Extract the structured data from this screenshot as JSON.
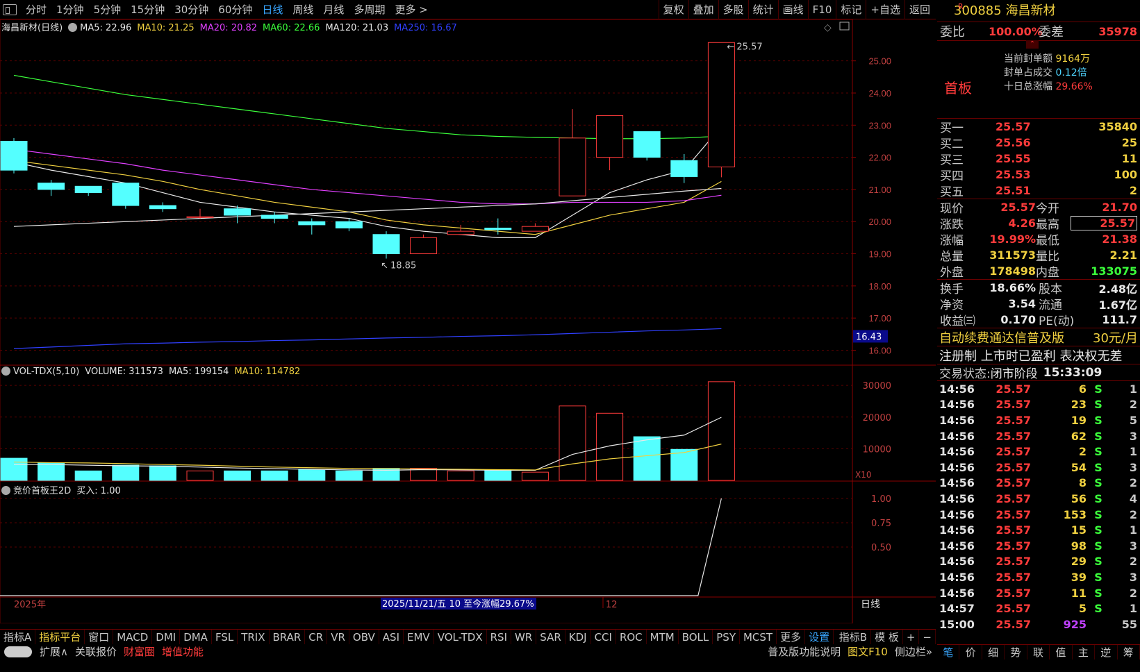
{
  "toolbar": {
    "periods": [
      "分时",
      "1分钟",
      "5分钟",
      "15分钟",
      "30分钟",
      "60分钟",
      "日线",
      "周线",
      "月线",
      "多周期",
      "更多 >"
    ],
    "active": "日线",
    "buttons": [
      "复权",
      "叠加",
      "多股",
      "统计",
      "画线",
      "F10",
      "标记",
      "+自选",
      "返回"
    ]
  },
  "main_legend": {
    "name": "海昌新材(日线)",
    "items": [
      {
        "label": "MA5: 22.96",
        "color": "#e8e8e8"
      },
      {
        "label": "MA10: 21.25",
        "color": "#f0d040"
      },
      {
        "label": "MA20: 20.82",
        "color": "#e040ff"
      },
      {
        "label": "MA60: 22.66",
        "color": "#3bff3b"
      },
      {
        "label": "MA120: 21.03",
        "color": "#e8e8e8"
      },
      {
        "label": "MA250: 16.67",
        "color": "#3040ff"
      }
    ]
  },
  "vol_legend": {
    "name": "VOL-TDX(5,10)",
    "items": [
      {
        "label": "VOLUME: 311573",
        "color": "#e8e8e8"
      },
      {
        "label": "MA5: 199154",
        "color": "#e8e8e8"
      },
      {
        "label": "MA10: 114782",
        "color": "#f0d040"
      }
    ]
  },
  "ind_legend": {
    "name": "竞价首板王2D",
    "items": [
      {
        "label": "买入: 1.00",
        "color": "#e8e8e8"
      }
    ]
  },
  "price_axis": {
    "labels": [
      "25.00",
      "24.00",
      "23.00",
      "22.00",
      "21.00",
      "20.00",
      "19.00",
      "18.00",
      "17.00",
      "16.00"
    ],
    "ma250_label": "16.43"
  },
  "vol_axis": {
    "labels": [
      "30000",
      "20000",
      "10000"
    ],
    "unit": "X10"
  },
  "ind_axis": {
    "labels": [
      "1.00",
      "0.75",
      "0.50"
    ]
  },
  "annotations": {
    "high": "25.57",
    "low": "18.85"
  },
  "time_axis": {
    "year": "2025年",
    "month": "12",
    "cursor": "2025/11/21/五 10 至今涨幅29.67%",
    "period": "日线"
  },
  "chart_data": {
    "type": "candlestick",
    "candles": [
      {
        "o": 21.6,
        "c": 22.5,
        "h": 22.6,
        "l": 21.5,
        "up": false
      },
      {
        "o": 21.2,
        "c": 21.0,
        "h": 21.3,
        "l": 20.8,
        "up": false
      },
      {
        "o": 21.1,
        "c": 20.9,
        "h": 21.1,
        "l": 20.8,
        "up": false
      },
      {
        "o": 21.2,
        "c": 20.5,
        "h": 21.2,
        "l": 20.4,
        "up": false
      },
      {
        "o": 20.5,
        "c": 20.4,
        "h": 20.6,
        "l": 20.3,
        "up": false
      },
      {
        "o": 20.15,
        "c": 20.15,
        "h": 20.4,
        "l": 20.1,
        "up": true
      },
      {
        "o": 20.4,
        "c": 20.2,
        "h": 20.5,
        "l": 19.95,
        "up": false
      },
      {
        "o": 20.2,
        "c": 20.1,
        "h": 20.3,
        "l": 19.95,
        "up": false
      },
      {
        "o": 20.0,
        "c": 19.9,
        "h": 20.1,
        "l": 19.6,
        "up": false
      },
      {
        "o": 20.0,
        "c": 19.8,
        "h": 20.1,
        "l": 19.7,
        "up": false
      },
      {
        "o": 19.6,
        "c": 19.0,
        "h": 19.7,
        "l": 18.85,
        "up": false
      },
      {
        "o": 19.0,
        "c": 19.5,
        "h": 19.6,
        "l": 19.0,
        "up": true
      },
      {
        "o": 19.6,
        "c": 19.7,
        "h": 19.9,
        "l": 19.6,
        "up": true
      },
      {
        "o": 19.8,
        "c": 19.75,
        "h": 20.1,
        "l": 19.6,
        "up": false
      },
      {
        "o": 19.7,
        "c": 19.85,
        "h": 19.95,
        "l": 19.7,
        "up": true
      },
      {
        "o": 20.8,
        "c": 22.6,
        "h": 23.5,
        "l": 20.8,
        "up": true
      },
      {
        "o": 22.0,
        "c": 23.3,
        "h": 23.3,
        "l": 21.6,
        "up": true
      },
      {
        "o": 22.8,
        "c": 22.0,
        "h": 22.8,
        "l": 21.9,
        "up": false
      },
      {
        "o": 21.9,
        "c": 21.4,
        "h": 22.1,
        "l": 21.2,
        "up": false
      },
      {
        "o": 21.7,
        "c": 25.57,
        "h": 25.57,
        "l": 21.38,
        "up": true
      }
    ],
    "volume": [
      {
        "v": 7000,
        "up": false
      },
      {
        "v": 5500,
        "up": false
      },
      {
        "v": 3000,
        "up": false
      },
      {
        "v": 4800,
        "up": false
      },
      {
        "v": 4600,
        "up": false
      },
      {
        "v": 3000,
        "up": true
      },
      {
        "v": 3000,
        "up": false
      },
      {
        "v": 3000,
        "up": false
      },
      {
        "v": 3400,
        "up": false
      },
      {
        "v": 3000,
        "up": false
      },
      {
        "v": 3800,
        "up": false
      },
      {
        "v": 3800,
        "up": true
      },
      {
        "v": 3000,
        "up": true
      },
      {
        "v": 3200,
        "up": false
      },
      {
        "v": 2600,
        "up": true
      },
      {
        "v": 23500,
        "up": true
      },
      {
        "v": 21200,
        "up": true
      },
      {
        "v": 13800,
        "up": false
      },
      {
        "v": 9800,
        "up": false
      },
      {
        "v": 31157,
        "up": true
      }
    ],
    "ma_series": [
      {
        "name": "MA5",
        "color": "#e8e8e8",
        "values": [
          21.85,
          21.6,
          21.4,
          21.2,
          20.9,
          20.6,
          20.45,
          20.3,
          20.2,
          20.1,
          19.85,
          19.7,
          19.6,
          19.5,
          19.5,
          20.2,
          20.9,
          21.3,
          21.6,
          22.96
        ]
      },
      {
        "name": "MA10",
        "color": "#f0d040",
        "values": [
          21.9,
          21.75,
          21.6,
          21.45,
          21.25,
          21.0,
          20.8,
          20.6,
          20.45,
          20.3,
          20.05,
          19.9,
          19.8,
          19.7,
          19.6,
          19.9,
          20.2,
          20.4,
          20.6,
          21.25
        ]
      },
      {
        "name": "MA20",
        "color": "#e040ff",
        "values": [
          22.25,
          22.1,
          21.95,
          21.8,
          21.6,
          21.45,
          21.3,
          21.15,
          21.0,
          20.9,
          20.8,
          20.7,
          20.6,
          20.55,
          20.55,
          20.6,
          20.6,
          20.6,
          20.65,
          20.82
        ]
      },
      {
        "name": "MA60",
        "color": "#3bff3b",
        "values": [
          24.55,
          24.35,
          24.15,
          23.95,
          23.8,
          23.65,
          23.5,
          23.35,
          23.2,
          23.05,
          22.9,
          22.8,
          22.7,
          22.65,
          22.62,
          22.6,
          22.58,
          22.58,
          22.6,
          22.66
        ]
      },
      {
        "name": "MA120",
        "color": "#e8e8e8",
        "values": [
          19.85,
          19.9,
          19.95,
          20.0,
          20.05,
          20.1,
          20.15,
          20.2,
          20.25,
          20.3,
          20.35,
          20.4,
          20.45,
          20.5,
          20.55,
          20.65,
          20.75,
          20.85,
          20.95,
          21.03
        ]
      },
      {
        "name": "MA250",
        "color": "#3040ff",
        "values": [
          16.05,
          16.1,
          16.15,
          16.2,
          16.22,
          16.25,
          16.27,
          16.3,
          16.32,
          16.35,
          16.38,
          16.4,
          16.43,
          16.45,
          16.48,
          16.52,
          16.56,
          16.6,
          16.63,
          16.67
        ]
      }
    ],
    "vol_ma5": [
      5000,
      5000,
      4800,
      4600,
      4500,
      4200,
      3900,
      3700,
      3500,
      3300,
      3200,
      3400,
      3300,
      3200,
      3200,
      8200,
      10900,
      12800,
      14300,
      19915
    ],
    "vol_ma10": [
      5800,
      5600,
      5500,
      5300,
      5000,
      4800,
      4500,
      4200,
      4000,
      3800,
      3700,
      3600,
      3500,
      3400,
      3300,
      5200,
      6800,
      7800,
      8800,
      11478
    ],
    "ind_values": [
      0,
      0,
      0,
      0,
      0,
      0,
      0,
      0,
      0,
      0,
      0,
      0,
      0,
      0,
      0,
      0,
      0,
      0,
      0,
      1.0
    ],
    "ylim": [
      15.6,
      25.9
    ]
  },
  "rp": {
    "code": "300885",
    "name": "海昌新材",
    "r_badge": "R",
    "weibi_l": "委比",
    "weibi_v": "100.00%",
    "weicha_l": "委差",
    "weicha_v": "35978",
    "board": "首板",
    "seal_l": "当前封单额",
    "seal_v": "9164万",
    "ratio_l": "封单占成交",
    "ratio_v": "0.12倍",
    "ten_l": "十日总涨幅",
    "ten_v": "29.66%",
    "bids": [
      [
        "买一",
        "25.57",
        "35840"
      ],
      [
        "买二",
        "25.56",
        "25"
      ],
      [
        "买三",
        "25.55",
        "11"
      ],
      [
        "买四",
        "25.53",
        "100"
      ],
      [
        "买五",
        "25.51",
        "2"
      ]
    ],
    "quote": [
      [
        "现价",
        "25.57",
        "今开",
        "21.70"
      ],
      [
        "涨跌",
        "4.26",
        "最高",
        "25.57"
      ],
      [
        "涨幅",
        "19.99%",
        "最低",
        "21.38"
      ],
      [
        "总量",
        "311573",
        "量比",
        "2.21"
      ],
      [
        "外盘",
        "178498",
        "内盘",
        "133075"
      ]
    ],
    "fin": [
      [
        "换手",
        "18.66%",
        "股本",
        "2.48亿"
      ],
      [
        "净资",
        "3.54",
        "流通",
        "1.67亿"
      ],
      [
        "收益㈢",
        "0.170",
        "PE(动)",
        "111.7"
      ]
    ],
    "ad": "自动续费通达信普及版",
    "ad_price": "30元/月",
    "tags": "注册制 上市时已盈利 表决权无差",
    "state_l": "交易状态:",
    "state_v": "闭市阶段",
    "state_t": "15:33:09",
    "ticks": [
      [
        "14:56",
        "25.57",
        "6",
        "S",
        "1"
      ],
      [
        "14:56",
        "25.57",
        "23",
        "S",
        "2"
      ],
      [
        "14:56",
        "25.57",
        "19",
        "S",
        "5"
      ],
      [
        "14:56",
        "25.57",
        "62",
        "S",
        "3"
      ],
      [
        "14:56",
        "25.57",
        "2",
        "S",
        "1"
      ],
      [
        "14:56",
        "25.57",
        "54",
        "S",
        "3"
      ],
      [
        "14:56",
        "25.57",
        "8",
        "S",
        "2"
      ],
      [
        "14:56",
        "25.57",
        "56",
        "S",
        "4"
      ],
      [
        "14:56",
        "25.57",
        "153",
        "S",
        "2"
      ],
      [
        "14:56",
        "25.57",
        "15",
        "S",
        "1"
      ],
      [
        "14:56",
        "25.57",
        "98",
        "S",
        "3"
      ],
      [
        "14:56",
        "25.57",
        "29",
        "S",
        "2"
      ],
      [
        "14:56",
        "25.57",
        "39",
        "S",
        "3"
      ],
      [
        "14:56",
        "25.57",
        "11",
        "S",
        "2"
      ],
      [
        "14:57",
        "25.57",
        "5",
        "S",
        "1"
      ],
      [
        "15:00",
        "25.57",
        "925",
        "",
        "55"
      ]
    ]
  },
  "bottom": {
    "left": "指标A",
    "tabs": [
      "指标平台",
      "窗口",
      "MACD",
      "DMI",
      "DMA",
      "FSL",
      "TRIX",
      "BRAR",
      "CR",
      "VR",
      "OBV",
      "ASI",
      "EMV",
      "VOL-TDX",
      "RSI",
      "WR",
      "SAR",
      "KDJ",
      "CCI",
      "ROC",
      "MTM",
      "BOLL",
      "PSY",
      "MCST",
      "更多",
      "设置"
    ],
    "right": [
      "指标B",
      "模 板",
      "+",
      "−"
    ],
    "row2": [
      "扩展∧",
      "关联报价",
      "财富圈",
      "增值功能"
    ],
    "row2_right": [
      "普及版功能说明",
      "图文F10",
      "侧边栏»"
    ]
  },
  "rtabs": [
    "笔",
    "价",
    "细",
    "势",
    "联",
    "值",
    "主",
    "逆",
    "筹"
  ]
}
